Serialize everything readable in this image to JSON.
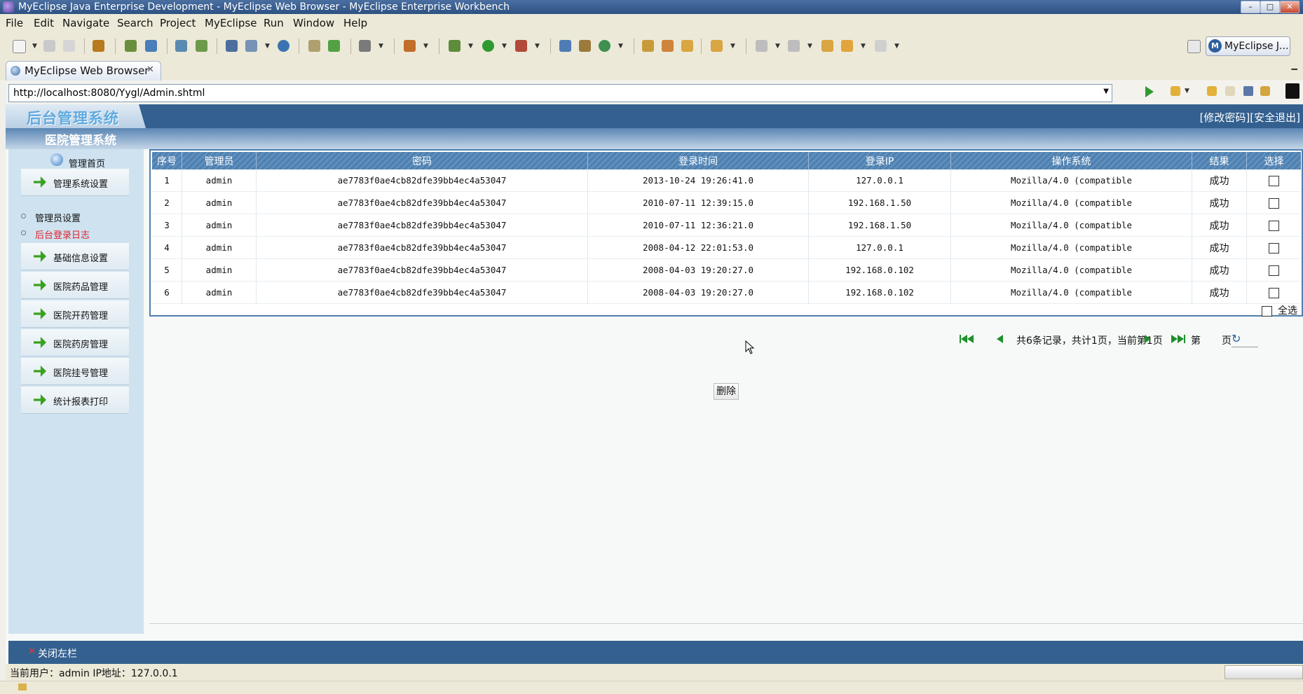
{
  "window": {
    "title": "MyEclipse Java Enterprise Development - MyEclipse Web Browser - MyEclipse Enterprise Workbench",
    "min": "–",
    "max": "□",
    "close": "✕"
  },
  "menu": [
    "File",
    "Edit",
    "Navigate",
    "Search",
    "Project",
    "MyEclipse",
    "Run",
    "Window",
    "Help"
  ],
  "perspective": {
    "label": "MyEclipse J..."
  },
  "browser_tab": {
    "label": "MyEclipse Web Browser",
    "close": "✕"
  },
  "address": {
    "url": "http://localhost:8080/Yygl/Admin.shtml"
  },
  "header": {
    "logo": "后台管理系统",
    "subtitle": "医院管理系统",
    "change_password": "[修改密码]",
    "logout": "[安全退出]"
  },
  "sidebar": {
    "home": "管理首页",
    "system_settings": "管理系统设置",
    "links": [
      "管理员设置",
      "后台登录日志"
    ],
    "active_link_color": "#e0202c",
    "sections": [
      "基础信息设置",
      "医院药品管理",
      "医院开药管理",
      "医院药房管理",
      "医院挂号管理",
      "统计报表打印"
    ]
  },
  "table": {
    "headers": [
      "序号",
      "管理员",
      "密码",
      "登录时间",
      "登录IP",
      "操作系统",
      "结果",
      "选择"
    ],
    "rows": [
      [
        "1",
        "admin",
        "ae7783f0ae4cb82dfe39bb4ec4a53047",
        "2013-10-24 19:26:41.0",
        "127.0.0.1",
        "Mozilla/4.0 (compatible",
        "成功"
      ],
      [
        "2",
        "admin",
        "ae7783f0ae4cb82dfe39bb4ec4a53047",
        "2010-07-11 12:39:15.0",
        "192.168.1.50",
        "Mozilla/4.0 (compatible",
        "成功"
      ],
      [
        "3",
        "admin",
        "ae7783f0ae4cb82dfe39bb4ec4a53047",
        "2010-07-11 12:36:21.0",
        "192.168.1.50",
        "Mozilla/4.0 (compatible",
        "成功"
      ],
      [
        "4",
        "admin",
        "ae7783f0ae4cb82dfe39bb4ec4a53047",
        "2008-04-12 22:01:53.0",
        "127.0.0.1",
        "Mozilla/4.0 (compatible",
        "成功"
      ],
      [
        "5",
        "admin",
        "ae7783f0ae4cb82dfe39bb4ec4a53047",
        "2008-04-03 19:20:27.0",
        "192.168.0.102",
        "Mozilla/4.0 (compatible",
        "成功"
      ],
      [
        "6",
        "admin",
        "ae7783f0ae4cb82dfe39bb4ec4a53047",
        "2008-04-03 19:20:27.0",
        "192.168.0.102",
        "Mozilla/4.0 (compatible",
        "成功"
      ]
    ],
    "select_all": "全选"
  },
  "pager": {
    "summary": "共6条记录，共计1页，当前第1页",
    "page_prefix": "第",
    "page_suffix": "页",
    "go": "↻"
  },
  "delete_label": "删除",
  "close_sidebar": {
    "x": "✕",
    "label": "关闭左栏"
  },
  "status": {
    "text": "当前用户：admin  IP地址：127.0.0.1"
  },
  "colors": {
    "header_blue": "#33608f",
    "grid_header": "#5f8fbd",
    "sidebar_bg": "#cfe2ef",
    "green_icon": "#3aa11e"
  }
}
